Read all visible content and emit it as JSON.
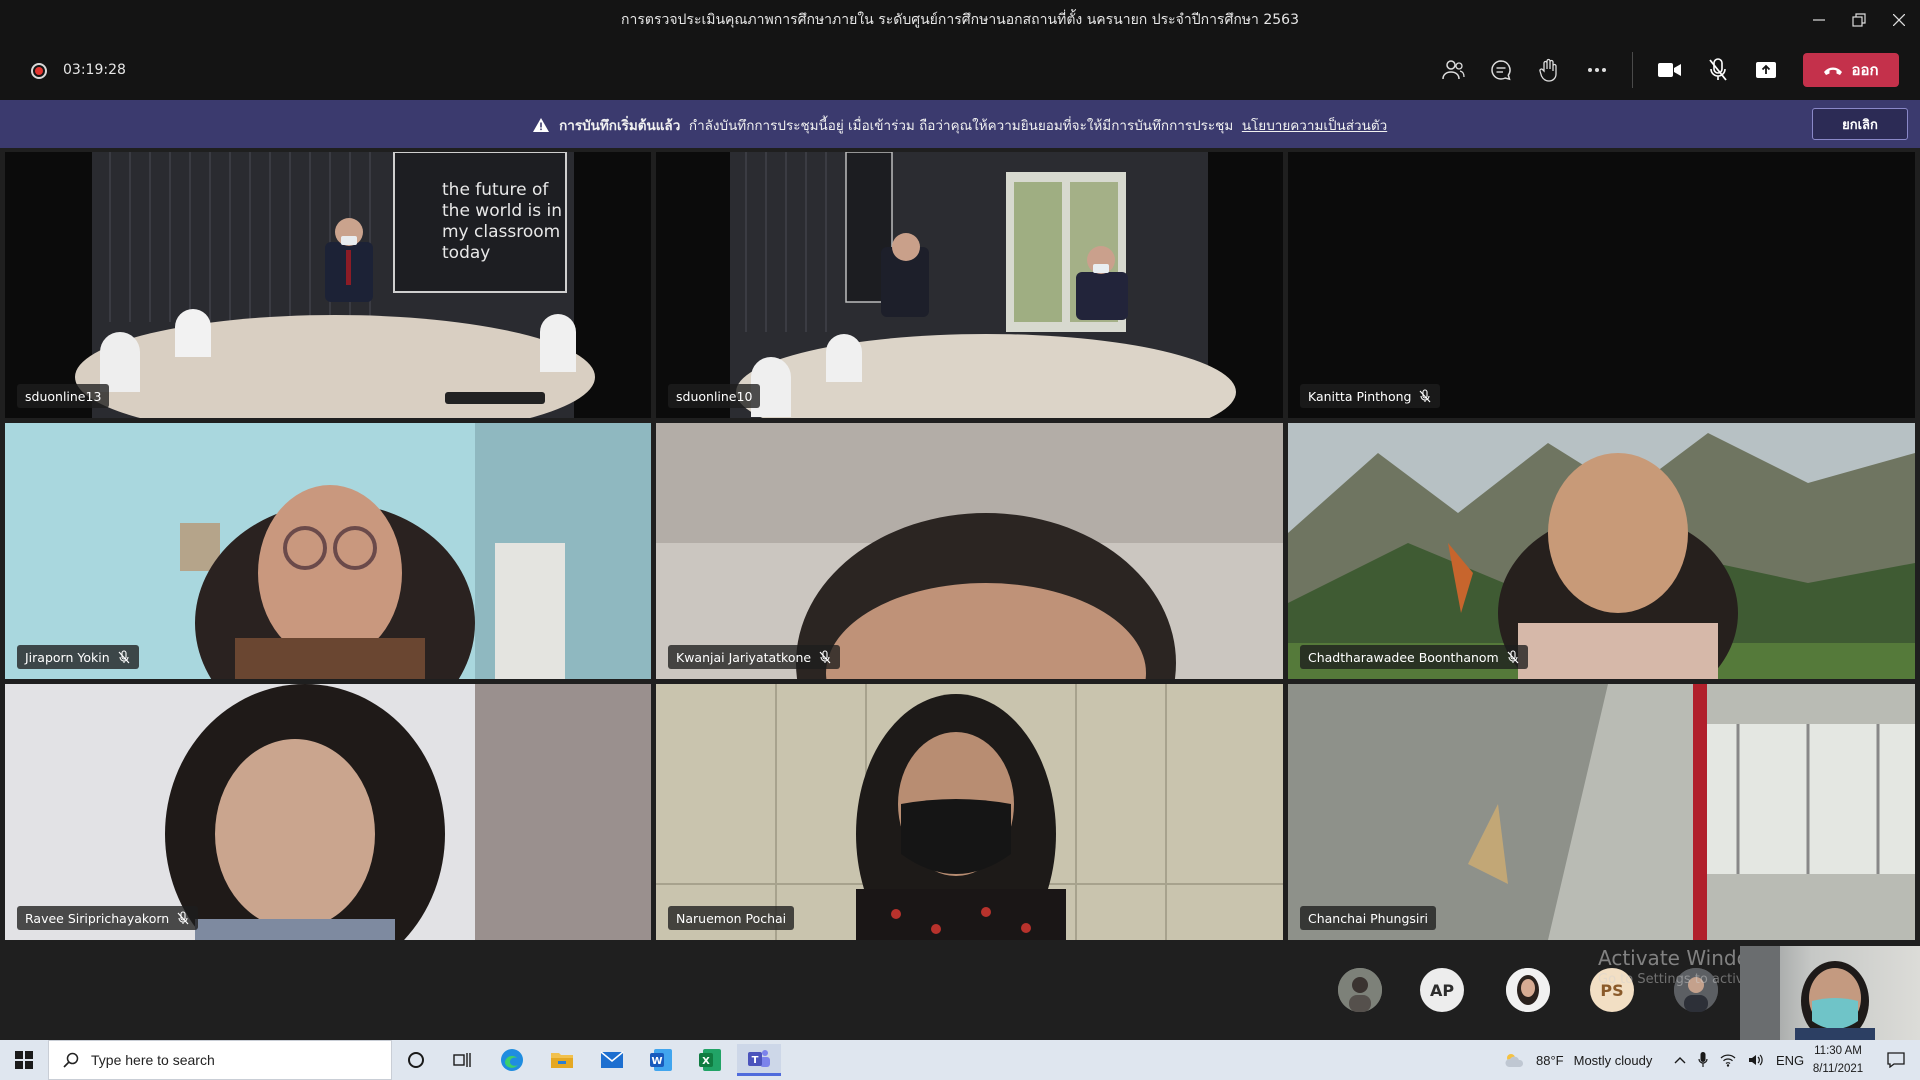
{
  "window": {
    "title": "การตรวจประเมินคุณภาพการศึกษาภายใน ระดับศูนย์การศึกษานอกสถานที่ตั้ง นครนายก ประจำปีการศึกษา 2563"
  },
  "toolbar": {
    "timer": "03:19:28",
    "leave_label": "ออก"
  },
  "banner": {
    "heading": "การบันทึกเริ่มต้นแล้ว",
    "message": "กำลังบันทึกการประชุมนี้อยู่ เมื่อเข้าร่วม ถือว่าคุณให้ความยินยอมที่จะให้มีการบันทึกการประชุม",
    "policy_link": "นโยบายความเป็นส่วนตัว",
    "dismiss_label": "ยกเลิก"
  },
  "participants": [
    {
      "name": "sduonline13",
      "muted": false
    },
    {
      "name": "sduonline10",
      "muted": false
    },
    {
      "name": "Kanitta Pinthong",
      "muted": true
    },
    {
      "name": "Jiraporn Yokin",
      "muted": true
    },
    {
      "name": "Kwanjai Jariyatatkone",
      "muted": true
    },
    {
      "name": "Chadtharawadee Boonthanom",
      "muted": true
    },
    {
      "name": "Ravee Siriprichayakorn",
      "muted": true
    },
    {
      "name": "Naruemon Pochai",
      "muted": false
    },
    {
      "name": "Chanchai Phungsiri",
      "muted": false
    }
  ],
  "wall_poster": {
    "text": "the future of the world is in my classroom today"
  },
  "avatars": [
    "AP",
    "PS"
  ],
  "watermark": {
    "line1": "Activate Windows",
    "line2": "Go to Settings to activate Windows."
  },
  "taskbar": {
    "search_placeholder": "Type here to search",
    "weather_temp": "88°F",
    "weather_text": "Mostly cloudy",
    "language": "ENG",
    "time": "11:30 AM",
    "date": "8/11/2021"
  },
  "colors": {
    "leave": "#c4314b",
    "banner": "#3b3a6e",
    "taskbar": "#dfe6ef"
  }
}
